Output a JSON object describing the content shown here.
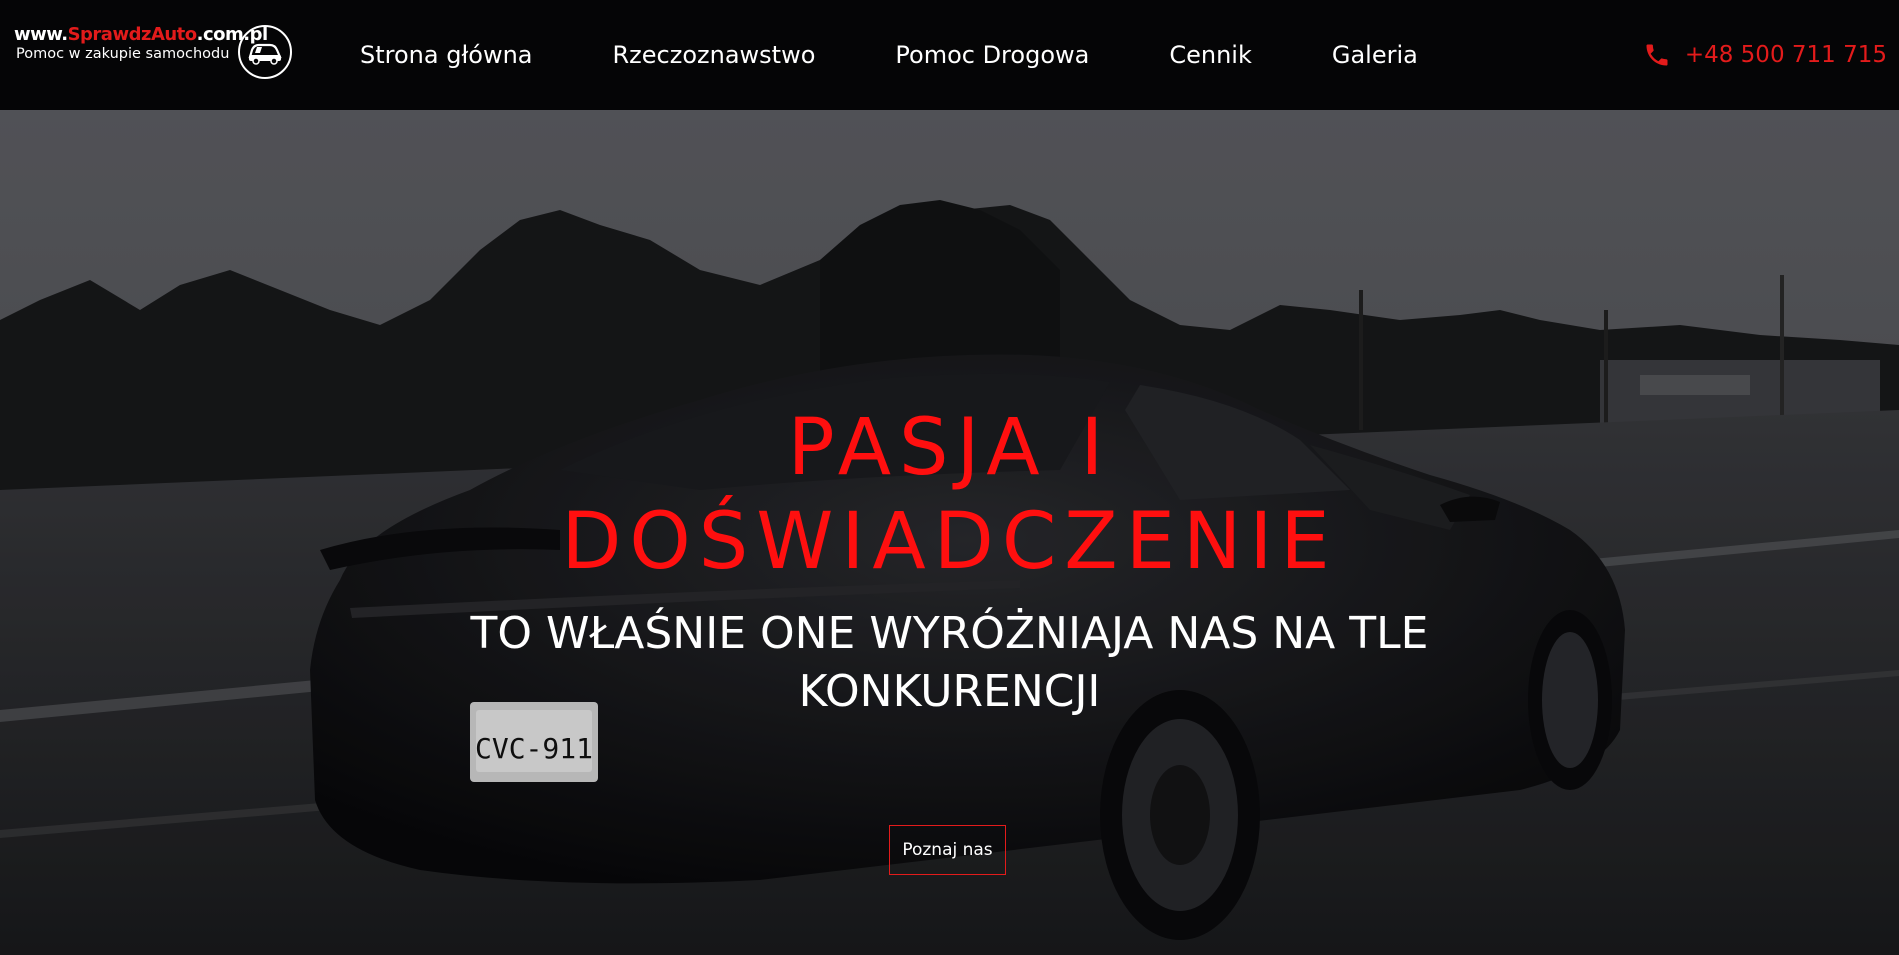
{
  "header": {
    "logo": {
      "domain_prefix": "www.",
      "domain_brand": "SprawdzAuto",
      "domain_suffix": ".com.pl",
      "tagline": "Pomoc w zakupie samochodu",
      "badge_icon": "car-in-circle-icon"
    },
    "nav": [
      {
        "label": "Strona główna"
      },
      {
        "label": "Rzeczoznawstwo"
      },
      {
        "label": "Pomoc Drogowa"
      },
      {
        "label": "Cennik"
      },
      {
        "label": "Galeria"
      }
    ],
    "phone": {
      "icon": "phone-icon",
      "number": "+48 500 711 715"
    }
  },
  "hero": {
    "title_line1": "PASJA I",
    "title_line2": "DOŚWIADCZENIE",
    "subtitle_line1": "TO WŁAŚNIE ONE WYRÓŻNIAJA NAS NA TLE",
    "subtitle_line2": "KONKURENCJI",
    "cta_label": "Poznaj nas",
    "background": "black sports car driving on road at dusk, monochrome photo",
    "plate_text": "CVC-911"
  },
  "colors": {
    "accent": "#e31b1b",
    "header_bg": "#050506",
    "text": "#ffffff"
  }
}
